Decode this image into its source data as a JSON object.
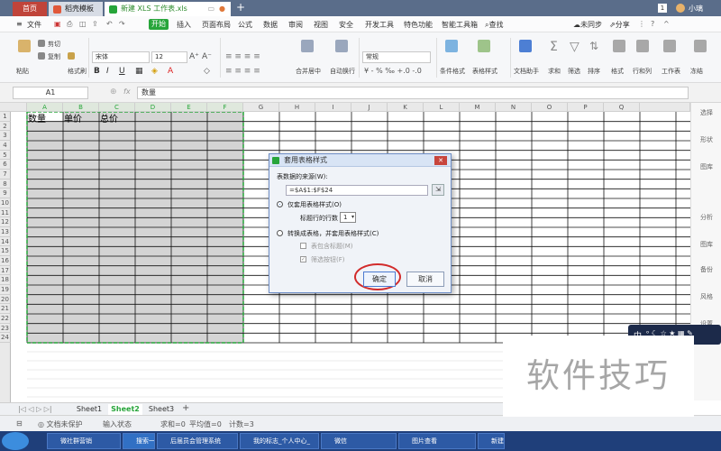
{
  "tabs": {
    "home": "首页",
    "dao": "稻壳模板",
    "file": "新建 XLS 工作表.xls"
  },
  "titlebar": {
    "badge": "1",
    "user": "小璃"
  },
  "menu": {
    "file": "文件",
    "items": [
      "开始",
      "插入",
      "页面布局",
      "公式",
      "数据",
      "审阅",
      "视图",
      "安全",
      "开发工具",
      "特色功能",
      "智能工具箱"
    ],
    "search": "查找",
    "sync": "未同步",
    "share": "分享"
  },
  "toolbar": {
    "paste": "粘贴",
    "cut": "剪切",
    "copy": "复制",
    "format_painter": "格式刷",
    "font": "宋体",
    "size": "12",
    "merge": "合并居中",
    "wrap": "自动换行",
    "number_format": "常规",
    "cond_format": "条件格式",
    "table_style": "表格样式",
    "doc_helper": "文档助手",
    "sum": "求和",
    "filter": "筛选",
    "sort": "排序",
    "format": "格式",
    "rowcol": "行和列",
    "sheet": "工作表",
    "freeze": "冻结"
  },
  "formula": {
    "cell_ref": "A1",
    "fx": "fx",
    "content": "数量"
  },
  "columns": [
    "A",
    "B",
    "C",
    "D",
    "E",
    "F",
    "G",
    "H",
    "I",
    "J",
    "K",
    "L",
    "M",
    "N",
    "O",
    "P",
    "Q"
  ],
  "rows": [
    "1",
    "2",
    "3",
    "4",
    "5",
    "6",
    "7",
    "8",
    "9",
    "10",
    "11",
    "12",
    "13",
    "14",
    "15",
    "16",
    "17",
    "18",
    "19",
    "20",
    "21",
    "22",
    "23",
    "24"
  ],
  "cells": {
    "A1": "数量",
    "B1": "单价",
    "C1": "总价"
  },
  "sidebar": [
    "选择",
    "形状",
    "图库",
    "分析",
    "图库",
    "备份",
    "风格",
    "设置"
  ],
  "sheets": [
    "Sheet1",
    "Sheet2",
    "Sheet3"
  ],
  "status": {
    "protect": "文档未保护",
    "input": "输入状态",
    "sum": "求和=0",
    "avg": "平均值=0",
    "count": "计数=3"
  },
  "taskbar": [
    "微社群营销",
    "搜索一下",
    "后届员会管理系统",
    "我的标志_个人中心_",
    "微信",
    "图片查看",
    "新建"
  ],
  "dialog": {
    "title": "套用表格样式",
    "source_label": "表数据的来源(W):",
    "source_value": "=$A$1:$F$24",
    "option1": "仅套用表格样式(O)",
    "header_rows_label": "标题行的行数",
    "header_rows_value": "1",
    "option2": "转换成表格，并套用表格样式(C)",
    "check1": "表包含标题(M)",
    "check2": "筛选按钮(F)",
    "ok": "确定",
    "cancel": "取消"
  },
  "ime": {
    "label": "中"
  },
  "watermark": "软件技巧",
  "colors": {
    "titlebar": "#5a6d8a",
    "accent_green": "#27a53a",
    "selection": "#cfcfcf",
    "ok_ring": "#d22b2b"
  }
}
